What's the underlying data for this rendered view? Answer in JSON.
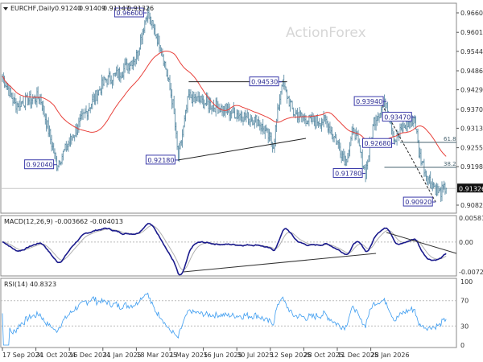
{
  "chart_data": {
    "type": "line",
    "title": "EURCHF,Daily",
    "ohlc_header": [
      "0.91240",
      "0.91409",
      "0.91147",
      "0.91326"
    ],
    "watermark": "ActionForex",
    "current_price": 0.91326,
    "current_price_label": "0.91326",
    "ylim": [
      0.9066,
      0.9692
    ],
    "y_ticks": [
      "0.96600",
      "0.96015",
      "0.95445",
      "0.94860",
      "0.94290",
      "0.93705",
      "0.93135",
      "0.92550",
      "0.91980",
      "0.90825"
    ],
    "y_tick_values": [
      0.966,
      0.96015,
      0.95445,
      0.9486,
      0.9429,
      0.93705,
      0.93135,
      0.9255,
      0.9198,
      0.90825
    ],
    "x_ticks": [
      "17 Sep 2024",
      "31 Oct 2024",
      "16 Dec 2024",
      "31 Jan 2025",
      "18 Mar 2025",
      "1 May 2025",
      "16 Jun 2025",
      "30 Jul 2025",
      "12 Sep 2025",
      "28 Oct 2025",
      "11 Dec 2025",
      "28 Jan 2026"
    ],
    "bars_per_tick": 32,
    "total_bars": 425,
    "price_anchors": [
      [
        0,
        0.9469
      ],
      [
        12,
        0.9385
      ],
      [
        36,
        0.9409
      ],
      [
        52,
        0.9204
      ],
      [
        67,
        0.9288
      ],
      [
        75,
        0.9336
      ],
      [
        98,
        0.9457
      ],
      [
        113,
        0.9481
      ],
      [
        128,
        0.953
      ],
      [
        138,
        0.966
      ],
      [
        152,
        0.9554
      ],
      [
        163,
        0.9385
      ],
      [
        168,
        0.9218
      ],
      [
        178,
        0.9409
      ],
      [
        198,
        0.9385
      ],
      [
        221,
        0.936
      ],
      [
        244,
        0.9336
      ],
      [
        259,
        0.9264
      ],
      [
        267,
        0.9453
      ],
      [
        278,
        0.936
      ],
      [
        294,
        0.9336
      ],
      [
        309,
        0.9336
      ],
      [
        321,
        0.9264
      ],
      [
        328,
        0.9215
      ],
      [
        336,
        0.9312
      ],
      [
        347,
        0.9178
      ],
      [
        355,
        0.9336
      ],
      [
        367,
        0.9394
      ],
      [
        375,
        0.9276
      ],
      [
        382,
        0.9312
      ],
      [
        394,
        0.9347
      ],
      [
        398,
        0.924
      ],
      [
        406,
        0.9167
      ],
      [
        417,
        0.9119
      ],
      [
        424,
        0.9133
      ]
    ],
    "moving_average": {
      "period": 50,
      "color": "#e8403a"
    },
    "annotations": [
      {
        "label": "0.96600",
        "bar": 138,
        "price": 0.966
      },
      {
        "label": "0.92040",
        "bar": 52,
        "price": 0.9204
      },
      {
        "label": "0.92180",
        "bar": 168,
        "price": 0.9218
      },
      {
        "label": "0.94530",
        "bar": 267,
        "price": 0.9453
      },
      {
        "label": "0.93940",
        "bar": 367,
        "price": 0.9394
      },
      {
        "label": "0.93470",
        "bar": 394,
        "price": 0.9347
      },
      {
        "label": "0.92680",
        "bar": 375,
        "price": 0.9268
      },
      {
        "label": "0.91780",
        "bar": 347,
        "price": 0.9178
      },
      {
        "label": "0.90920",
        "bar": 414,
        "price": 0.9092
      }
    ],
    "trendlines": [
      {
        "from": [
          168,
          0.9218
        ],
        "to": [
          290,
          0.9283
        ],
        "style": "solid"
      },
      {
        "from": [
          178,
          0.9453
        ],
        "to": [
          272,
          0.9453
        ],
        "style": "solid"
      },
      {
        "from": [
          361,
          0.9394
        ],
        "to": [
          414,
          0.9092
        ],
        "style": "dashed"
      }
    ],
    "fib_levels": [
      {
        "label": "61.8",
        "price": 0.9271,
        "from_bar": 380
      },
      {
        "label": "38.2",
        "price": 0.9196,
        "from_bar": 365
      }
    ],
    "macd": {
      "label": "MACD(12,26,9) -0.003662 -0.004013",
      "ylim": [
        -0.0076,
        0.0062
      ],
      "y_ticks": [
        "0.005814",
        "0.00",
        "-0.007222"
      ],
      "y_tick_values": [
        0.005814,
        0,
        -0.007222
      ],
      "trendlines": [
        {
          "from": [
            173,
            -0.00722
          ],
          "to": [
            357,
            -0.00275
          ]
        },
        {
          "from": [
            367,
            0.00231
          ],
          "to": [
            434,
            -0.00275
          ]
        }
      ]
    },
    "rsi": {
      "label": "RSI(14) 40.8323",
      "ylim": [
        0,
        100
      ],
      "y_ticks": [
        "100",
        "70",
        "30",
        "0"
      ],
      "y_tick_values": [
        100,
        70,
        30,
        0
      ]
    },
    "colors": {
      "bars": "#5e8ea6",
      "macd": "#1a1a8c",
      "signal": "#b0b0b0",
      "rsi": "#3c9cf0",
      "annotation": "#3a3aaa"
    }
  }
}
